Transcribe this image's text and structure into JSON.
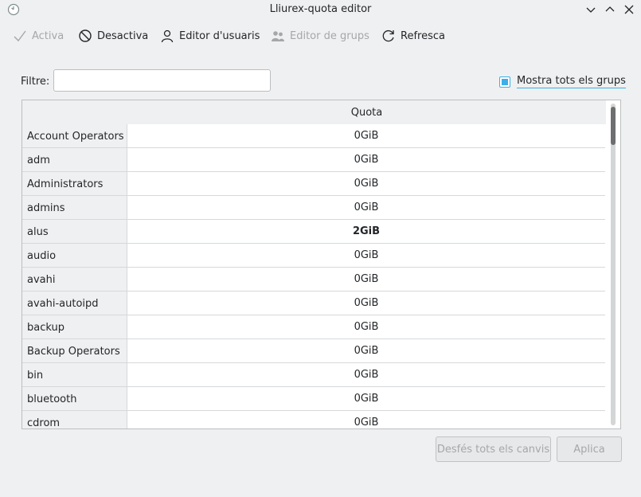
{
  "window": {
    "title": "Lliurex-quota editor"
  },
  "toolbar": {
    "activa": "Activa",
    "desactiva": "Desactiva",
    "user_editor": "Editor d'usuaris",
    "group_editor": "Editor de grups",
    "refresh": "Refresca"
  },
  "filter": {
    "label": "Filtre:",
    "value": ""
  },
  "show_all": {
    "label": "Mostra tots els grups",
    "checked": true
  },
  "table": {
    "header": "Quota",
    "rows": [
      {
        "name": "Account Operators",
        "quota": "0GiB"
      },
      {
        "name": "adm",
        "quota": "0GiB"
      },
      {
        "name": "Administrators",
        "quota": "0GiB"
      },
      {
        "name": "admins",
        "quota": "0GiB"
      },
      {
        "name": "alus",
        "quota": "2GiB",
        "bold": true
      },
      {
        "name": "audio",
        "quota": "0GiB"
      },
      {
        "name": "avahi",
        "quota": "0GiB"
      },
      {
        "name": "avahi-autoipd",
        "quota": "0GiB"
      },
      {
        "name": "backup",
        "quota": "0GiB"
      },
      {
        "name": "Backup Operators",
        "quota": "0GiB"
      },
      {
        "name": "bin",
        "quota": "0GiB"
      },
      {
        "name": "bluetooth",
        "quota": "0GiB"
      },
      {
        "name": "cdrom",
        "quota": "0GiB"
      }
    ]
  },
  "buttons": {
    "undo_all": "Desfés tots els canvis",
    "apply": "Aplica"
  },
  "colors": {
    "accent": "#3daee9",
    "disabled_text": "#a5a7a9"
  }
}
